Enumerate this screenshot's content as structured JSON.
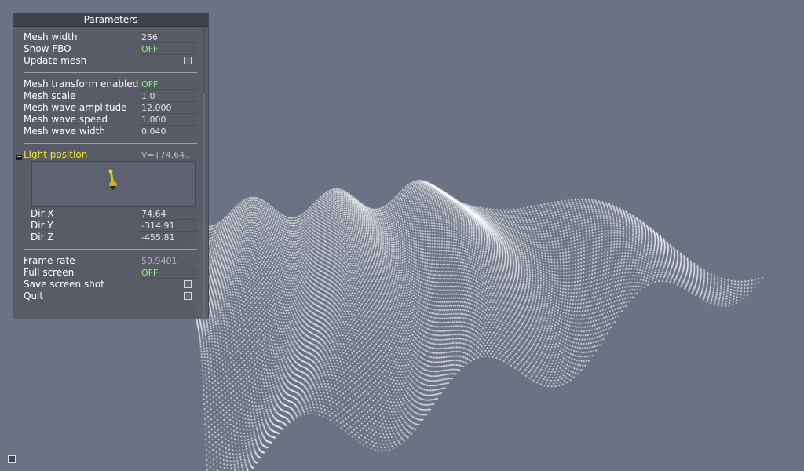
{
  "panel": {
    "title": "Parameters",
    "rows": {
      "mesh_width": {
        "label": "Mesh width",
        "value": "256"
      },
      "show_fbo": {
        "label": "Show FBO",
        "value": "OFF"
      },
      "update_mesh": {
        "label": "Update mesh"
      },
      "transform_enabled": {
        "label": "Mesh transform enabled",
        "value": "OFF"
      },
      "mesh_scale": {
        "label": "Mesh scale",
        "value": "1.0"
      },
      "wave_amplitude": {
        "label": "Mesh wave amplitude",
        "value": "12.000"
      },
      "wave_speed": {
        "label": "Mesh wave speed",
        "value": "1.000"
      },
      "wave_width": {
        "label": "Mesh wave width",
        "value": "0.040"
      },
      "light_position": {
        "label": "Light position",
        "value": "V={74.64.."
      },
      "dir_x": {
        "label": "Dir X",
        "value": "74.64"
      },
      "dir_y": {
        "label": "Dir Y",
        "value": "-314.91"
      },
      "dir_z": {
        "label": "Dir Z",
        "value": "-455.81"
      },
      "frame_rate": {
        "label": "Frame rate",
        "value": "59.9401"
      },
      "full_screen": {
        "label": "Full screen",
        "value": "OFF"
      },
      "save_screenshot": {
        "label": "Save screen shot"
      },
      "quit": {
        "label": "Quit"
      }
    }
  },
  "colors": {
    "background": "#6b7283",
    "panel": "#565a65",
    "value_green": "#8ff27b",
    "highlight_yellow": "#f2e61c",
    "mesh_points": "#ffffff"
  },
  "icons": {
    "direction_widget": "arrow-direction-icon",
    "collapse": "minus-icon",
    "corner": "help-icon"
  }
}
